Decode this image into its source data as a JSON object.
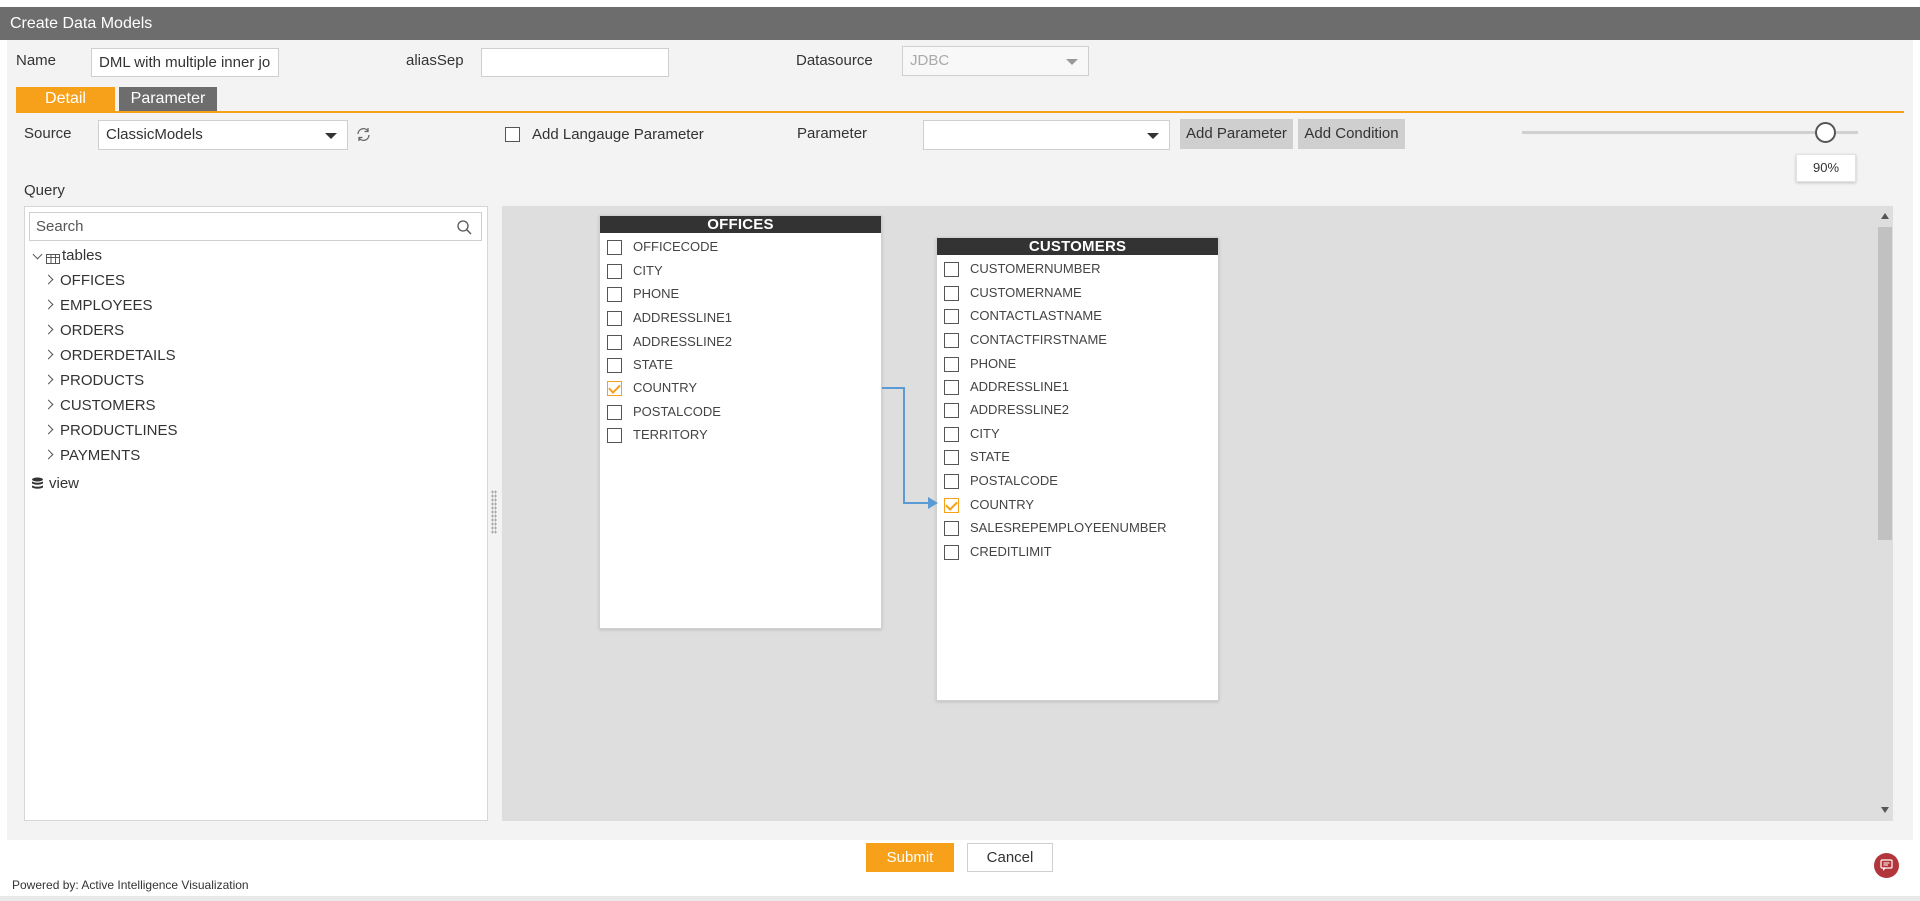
{
  "window": {
    "title": "Create Data Models"
  },
  "form": {
    "name_label": "Name",
    "name_value": "DML with multiple inner jo",
    "alias_label": "aliasSep",
    "alias_value": "",
    "datasource_label": "Datasource",
    "datasource_value": "JDBC"
  },
  "tabs": [
    {
      "label": "Detail",
      "active": true
    },
    {
      "label": "Parameter",
      "active": false
    }
  ],
  "toolbar": {
    "source_label": "Source",
    "source_value": "ClassicModels",
    "add_language_param_label": "Add Langauge Parameter",
    "add_language_param_checked": false,
    "parameter_label": "Parameter",
    "parameter_value": "",
    "add_parameter_label": "Add Parameter",
    "add_condition_label": "Add Condition",
    "zoom_percent": 90,
    "zoom_label": "90%"
  },
  "query": {
    "label": "Query",
    "search_placeholder": "Search",
    "tables_label": "tables",
    "tables": [
      "OFFICES",
      "EMPLOYEES",
      "ORDERS",
      "ORDERDETAILS",
      "PRODUCTS",
      "CUSTOMERS",
      "PRODUCTLINES",
      "PAYMENTS"
    ],
    "view_label": "view"
  },
  "diagram": {
    "tables": [
      {
        "name": "OFFICES",
        "columns": [
          {
            "name": "OFFICECODE",
            "checked": false
          },
          {
            "name": "CITY",
            "checked": false
          },
          {
            "name": "PHONE",
            "checked": false
          },
          {
            "name": "ADDRESSLINE1",
            "checked": false
          },
          {
            "name": "ADDRESSLINE2",
            "checked": false
          },
          {
            "name": "STATE",
            "checked": false
          },
          {
            "name": "COUNTRY",
            "checked": true
          },
          {
            "name": "POSTALCODE",
            "checked": false
          },
          {
            "name": "TERRITORY",
            "checked": false
          }
        ]
      },
      {
        "name": "CUSTOMERS",
        "columns": [
          {
            "name": "CUSTOMERNUMBER",
            "checked": false
          },
          {
            "name": "CUSTOMERNAME",
            "checked": false
          },
          {
            "name": "CONTACTLASTNAME",
            "checked": false
          },
          {
            "name": "CONTACTFIRSTNAME",
            "checked": false
          },
          {
            "name": "PHONE",
            "checked": false
          },
          {
            "name": "ADDRESSLINE1",
            "checked": false
          },
          {
            "name": "ADDRESSLINE2",
            "checked": false
          },
          {
            "name": "CITY",
            "checked": false
          },
          {
            "name": "STATE",
            "checked": false
          },
          {
            "name": "POSTALCODE",
            "checked": false
          },
          {
            "name": "COUNTRY",
            "checked": true
          },
          {
            "name": "SALESREPEMPLOYEENUMBER",
            "checked": false
          },
          {
            "name": "CREDITLIMIT",
            "checked": false
          }
        ]
      }
    ],
    "joins": [
      {
        "from_table": "OFFICES",
        "from_column": "COUNTRY",
        "to_table": "CUSTOMERS",
        "to_column": "COUNTRY"
      }
    ]
  },
  "actions": {
    "submit_label": "Submit",
    "cancel_label": "Cancel"
  },
  "footer": {
    "powered_by": "Powered by: Active Intelligence Visualization"
  },
  "colors": {
    "accent": "#f7a11a",
    "titlebar": "#6d6d6d",
    "join_line": "#5b9bd5",
    "chat": "#b1353a"
  }
}
